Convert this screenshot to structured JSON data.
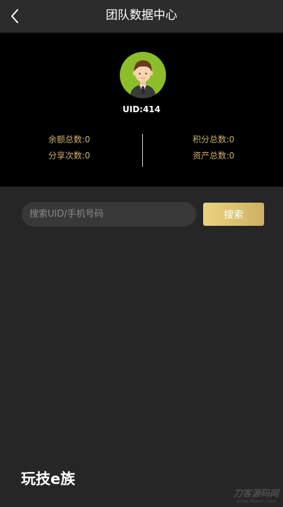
{
  "header": {
    "title": "团队数据中心"
  },
  "profile": {
    "uid": "UID:414",
    "stats": {
      "balance_total": "余额总数:0",
      "share_count": "分享次数:0",
      "points_total": "积分总数:0",
      "assets_total": "资产总数:0"
    }
  },
  "search": {
    "placeholder": "搜索UID/手机号码",
    "button_label": "搜索"
  },
  "footer": {
    "brand": "玩技e族",
    "watermark_main": "刀客源码网",
    "watermark_sub": "www.dkewl.com"
  },
  "colors": {
    "accent_gold": "#cdb06a",
    "button_gradient_start": "#ead37f",
    "button_gradient_end": "#cdb163",
    "avatar_bg": "#8cbe2a"
  }
}
